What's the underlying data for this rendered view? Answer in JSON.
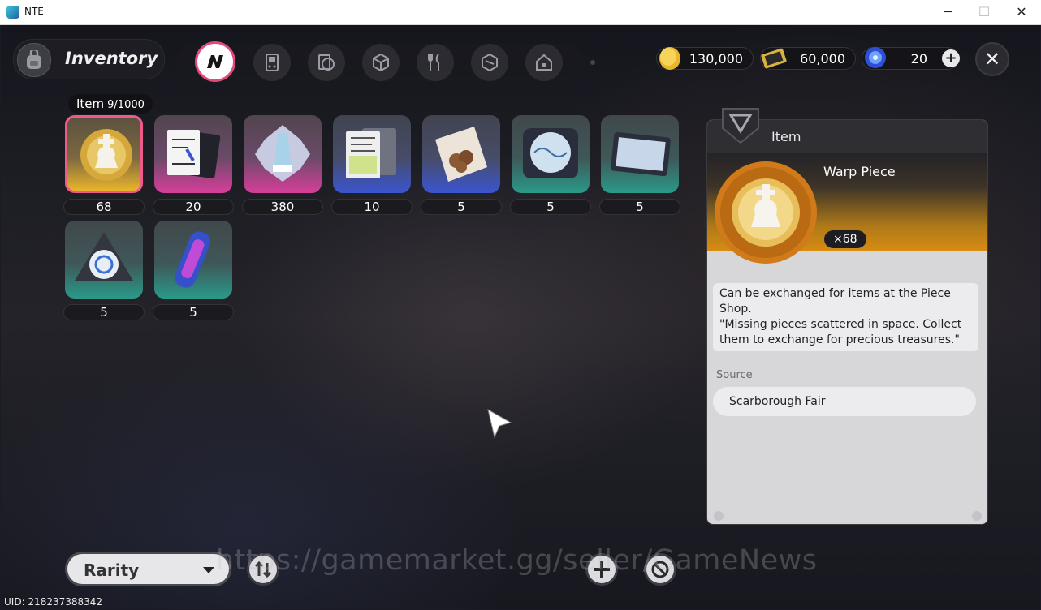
{
  "window": {
    "title": "NTE",
    "minimize_glyph": "─",
    "maximize_glyph": "☐",
    "close_glyph": "✕"
  },
  "header": {
    "title": "Inventory",
    "icon": "backpack-icon"
  },
  "tabs": [
    {
      "icon": "n-logo-icon",
      "active": true
    },
    {
      "icon": "handheld-console-icon",
      "active": false
    },
    {
      "icon": "disc-card-icon",
      "active": false
    },
    {
      "icon": "cube-box-icon",
      "active": false
    },
    {
      "icon": "fork-knife-icon",
      "active": false
    },
    {
      "icon": "hex-box-icon",
      "active": false
    },
    {
      "icon": "house-icon",
      "active": false
    }
  ],
  "currencies": [
    {
      "icon": "gold-coin-icon",
      "value": "130,000"
    },
    {
      "icon": "ticket-card-icon",
      "value": "60,000"
    },
    {
      "icon": "blue-crystal-icon",
      "value": "20"
    }
  ],
  "close_button": {
    "glyph": "✕"
  },
  "grid": {
    "category_label": "Item",
    "count": "9/1000",
    "items": [
      {
        "qty": "68",
        "rarity": "gold",
        "icon": "chess-king-icon",
        "selected": true
      },
      {
        "qty": "20",
        "rarity": "pink",
        "icon": "cards-icon",
        "selected": false
      },
      {
        "qty": "380",
        "rarity": "pink",
        "icon": "crystal-tower-icon",
        "selected": false
      },
      {
        "qty": "10",
        "rarity": "blue",
        "icon": "document-cards-icon",
        "selected": false
      },
      {
        "qty": "5",
        "rarity": "blue",
        "icon": "snack-bag-icon",
        "selected": false
      },
      {
        "qty": "5",
        "rarity": "teal",
        "icon": "radar-device-icon",
        "selected": false
      },
      {
        "qty": "5",
        "rarity": "teal",
        "icon": "tablet-icon",
        "selected": false
      },
      {
        "qty": "5",
        "rarity": "teal",
        "icon": "triangle-compass-icon",
        "selected": false
      },
      {
        "qty": "5",
        "rarity": "teal",
        "icon": "energy-canister-icon",
        "selected": false
      }
    ]
  },
  "detail": {
    "category": "Item",
    "name": "Warp Piece",
    "quantity": "×68",
    "description": "Can be exchanged for items at the Piece Shop.\n\"Missing pieces scattered in space. Collect them to exchange for precious treasures.\"",
    "source_label": "Source",
    "sources": [
      "Scarborough Fair"
    ]
  },
  "bottom": {
    "sort_label": "Rarity",
    "sort_order_icon": "sort-arrows-icon",
    "add_icon": "crosshair-plus-icon",
    "lock_icon": "no-symbol-icon"
  },
  "uid": "UID: 218237388342",
  "watermark": "https://gamemarket.gg/seller/GameNews",
  "colors": {
    "selected_border": "#ef5a8a",
    "gold": "#e9b52c",
    "pink": "#d83e9a",
    "blue": "#3b55d0",
    "teal": "#2a9a89"
  }
}
